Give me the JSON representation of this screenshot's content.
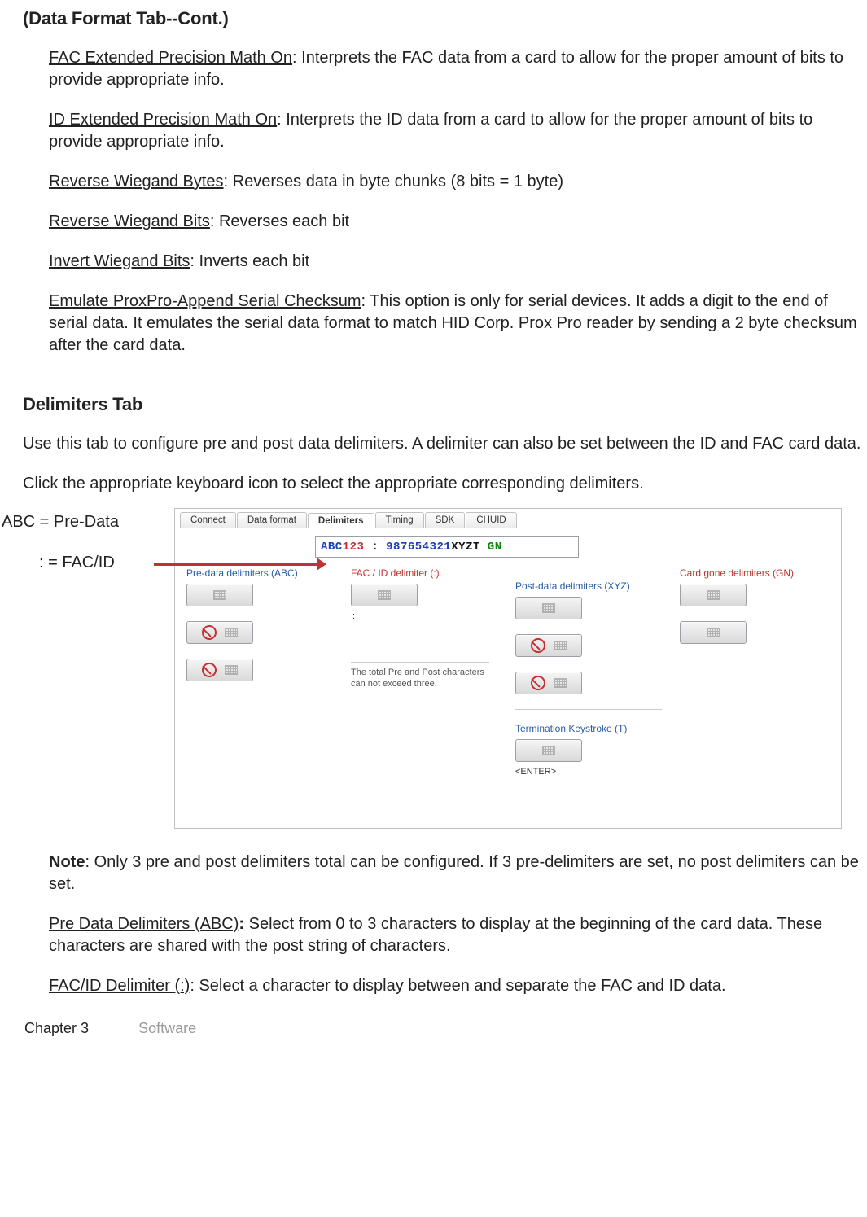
{
  "h1": "(Data Format Tab--Cont.)",
  "defs": {
    "fac_ext_t": "FAC Extended Precision Math On",
    "fac_ext_d": ": Interprets the FAC data from a card to allow for the proper amount of bits to provide appropriate info.",
    "id_ext_t": "ID Extended Precision Math On",
    "id_ext_d": ": Interprets the ID data from a card to allow for the proper amount of bits to provide appropriate info.",
    "rev_bytes_t": "Reverse Wiegand Bytes",
    "rev_bytes_d": ": Reverses data in byte chunks (8 bits = 1 byte)",
    "rev_bits_t": "Reverse Wiegand Bits",
    "rev_bits_d": ": Reverses each bit",
    "inv_bits_t": "Invert Wiegand Bits",
    "inv_bits_d": ": Inverts each bit",
    "emu_t": "Emulate ProxPro-Append Serial Checksum",
    "emu_d": ": This option is only for serial devices. It adds a digit to the end of serial data. It emulates the serial data format to match HID Corp. Prox Pro reader by sending a 2 byte checksum after the card data."
  },
  "h2": "Delimiters Tab",
  "intro1": "Use this tab to configure pre and post data delimiters. A delimiter can also be set between the ID and FAC card data.",
  "intro2": "Click the appropriate keyboard icon to select the appropriate corresponding delimiters.",
  "callout1": "ABC = Pre-Data",
  "callout2": ": = FAC/ID",
  "tabs": [
    "Connect",
    "Data format",
    "Delimiters",
    "Timing",
    "SDK",
    "CHUID"
  ],
  "example": {
    "pre": "ABC",
    "fac": "123",
    "sep": " : ",
    "id": "987654321",
    "post": "XYZ",
    "tk": "T",
    "gn": "  GN"
  },
  "groups": {
    "pre": "Pre-data delimiters (ABC)",
    "facid": "FAC / ID delimiter (:)",
    "post": "Post-data delimiters (XYZ)",
    "gone": "Card gone delimiters (GN)",
    "term": "Termination Keystroke (T)"
  },
  "facid_char": ":",
  "kbd_note": "The total Pre and Post characters can not exceed three.",
  "term_val": "<ENTER>",
  "note_label": "Note",
  "note_body": ": Only 3 pre and post delimiters total can be configured. If 3 pre-delimiters are set, no post delimiters can be set.",
  "pre_abc_t": "Pre Data Delimiters (ABC)",
  "pre_abc_b": " Select from 0 to 3 characters to display at the beginning of the card data. These characters are shared with the post string of characters.",
  "facid_t": "FAC/ID Delimiter (:)",
  "facid_b": ": Select a character to display between and separate the FAC and ID data.",
  "footer_ch": "Chapter 3",
  "footer_pg": "Software"
}
